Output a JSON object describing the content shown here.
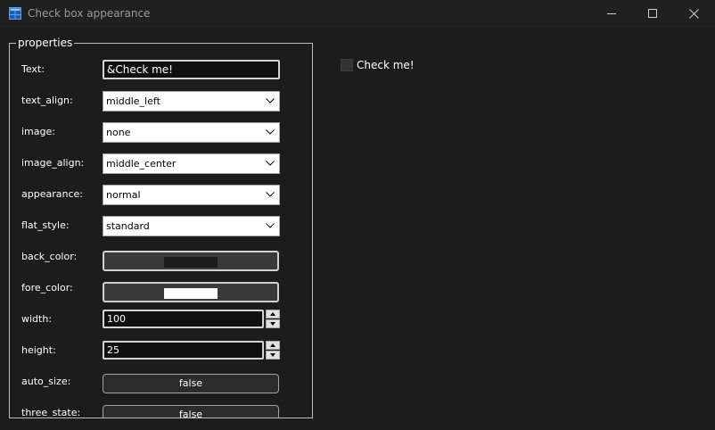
{
  "window": {
    "title": "Check box appearance",
    "icon": "app-window-icon",
    "controls": [
      "minimize-icon",
      "maximize-icon",
      "close-icon"
    ]
  },
  "properties": {
    "legend": "properties",
    "text": {
      "label": "Text:",
      "value": "&Check me!"
    },
    "text_align": {
      "label": "text_align:",
      "value": "middle_left"
    },
    "image": {
      "label": "image:",
      "value": "none"
    },
    "image_align": {
      "label": "image_align:",
      "value": "middle_center"
    },
    "appearance": {
      "label": "appearance:",
      "value": "normal"
    },
    "flat_style": {
      "label": "flat_style:",
      "value": "standard"
    },
    "back_color": {
      "label": "back_color:",
      "color": "#1c1c1c"
    },
    "fore_color": {
      "label": "fore_color:",
      "color": "#ffffff"
    },
    "width": {
      "label": "width:",
      "value": "100"
    },
    "height": {
      "label": "height:",
      "value": "25"
    },
    "auto_size": {
      "label": "auto_size:",
      "value": "false"
    },
    "three_state": {
      "label": "three_state:",
      "value": "false"
    }
  },
  "preview": {
    "label": "Check me!",
    "checked": false
  }
}
